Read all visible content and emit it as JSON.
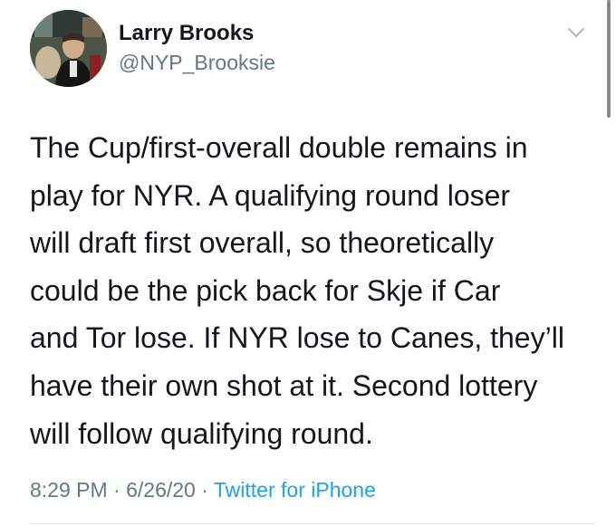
{
  "user": {
    "name": "Larry Brooks",
    "handle": "@NYP_Brooksie",
    "avatar_icon": "profile-photo"
  },
  "menu_icon": "chevron-down-icon",
  "tweet": {
    "lines": [
      "The Cup/first-overall double remains in",
      "play for NYR. A qualifying round loser",
      "will draft first overall, so theoretically",
      "could be the pick back for Skje if Car",
      "and Tor lose. If NYR lose to Canes, they’ll",
      "have their own shot at it. Second lottery",
      "will follow qualifying round."
    ]
  },
  "meta": {
    "time": "8:29 PM",
    "separator": " · ",
    "date": "6/26/20",
    "source": "Twitter for iPhone"
  },
  "colors": {
    "text": "#14171a",
    "secondary": "#657786",
    "link": "#1da1f2",
    "divider": "#e1e8ed"
  }
}
